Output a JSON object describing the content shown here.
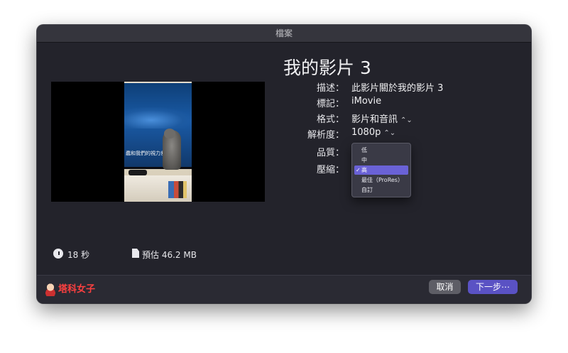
{
  "window": {
    "title": "檔案"
  },
  "video": {
    "title": "我的影片 3",
    "subtitle_overlay": "蠢和我們的視力差異"
  },
  "fields": [
    {
      "label": "描述：",
      "value": "此影片關於我的影片 3"
    },
    {
      "label": "標記：",
      "value": "iMovie"
    },
    {
      "label": "格式：",
      "value": "影片和音訊"
    },
    {
      "label": "解析度：",
      "value": "1080p"
    },
    {
      "label": "品質：",
      "value": ""
    },
    {
      "label": "壓縮：",
      "value": ""
    }
  ],
  "quality_menu": {
    "options": [
      "低",
      "中",
      "高",
      "最佳（ProRes）",
      "自訂"
    ],
    "selected": "高"
  },
  "info": {
    "duration": "18 秒",
    "size": "預估 46.2 MB"
  },
  "brand": "塔科女子",
  "buttons": {
    "cancel": "取消",
    "next": "下一步⋯"
  },
  "colors": {
    "accent": "#5a52c4",
    "highlight": "#6a62d6",
    "brand": "#ff4040",
    "background": "#23232b"
  },
  "icons": {
    "duration": "clock-icon",
    "size": "document-icon",
    "popup": "up-down-chevron-icon",
    "selected": "checkmark-icon"
  }
}
